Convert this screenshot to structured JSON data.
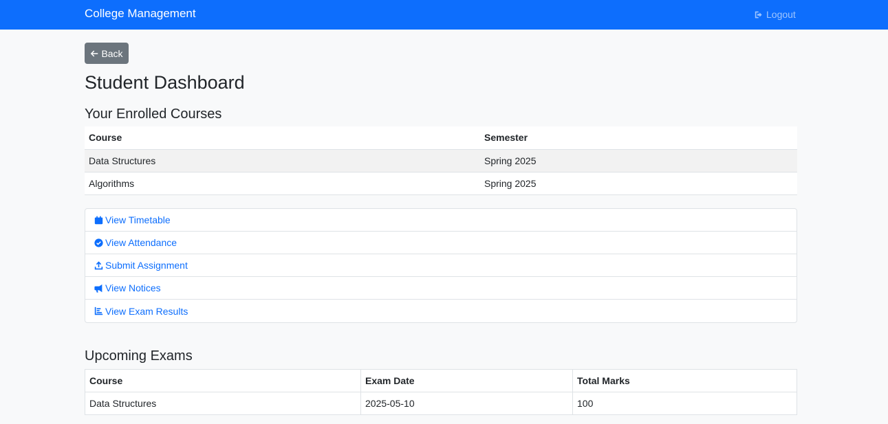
{
  "navbar": {
    "brand": "College Management",
    "logout_label": "Logout"
  },
  "back_label": "Back",
  "page_title": "Student Dashboard",
  "enrolled": {
    "title": "Your Enrolled Courses",
    "headers": [
      "Course",
      "Semester"
    ],
    "rows": [
      [
        "Data Structures",
        "Spring 2025"
      ],
      [
        "Algorithms",
        "Spring 2025"
      ]
    ]
  },
  "links": [
    {
      "label": "View Timetable",
      "icon": "calendar-icon"
    },
    {
      "label": "View Attendance",
      "icon": "check-circle-icon"
    },
    {
      "label": "Submit Assignment",
      "icon": "upload-icon"
    },
    {
      "label": "View Notices",
      "icon": "megaphone-icon"
    },
    {
      "label": "View Exam Results",
      "icon": "chart-icon"
    }
  ],
  "exams": {
    "title": "Upcoming Exams",
    "headers": [
      "Course",
      "Exam Date",
      "Total Marks"
    ],
    "rows": [
      [
        "Data Structures",
        "2025-05-10",
        "100"
      ]
    ]
  },
  "colors": {
    "primary": "#0d6efd",
    "secondary": "#6c757d",
    "background": "#f8f9fa"
  }
}
